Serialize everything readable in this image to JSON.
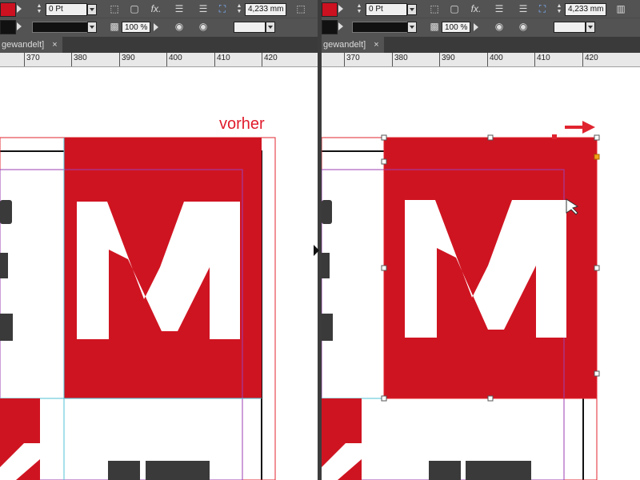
{
  "toolbar": {
    "stroke_weight": "0 Pt",
    "opacity": "100 %",
    "width_value": "4,233 mm",
    "fx_label": "fx."
  },
  "document_tab": {
    "title": "gewandelt]",
    "close": "×"
  },
  "ruler": {
    "left_ticks": [
      "370",
      "380",
      "390",
      "400",
      "410",
      "420"
    ],
    "right_ticks": [
      "370",
      "380",
      "390",
      "400",
      "410",
      "420"
    ]
  },
  "annotation": {
    "vorher": "vorher"
  },
  "logo_letter": "M",
  "colors": {
    "accent_red": "#cf1421",
    "frame_red": "#e0242f",
    "guide_purple": "#9b3fb3",
    "guide_cyan": "#4fc3d6",
    "handle_orange": "#f3a21a"
  },
  "icons": [
    "fill-swatch-icon",
    "stroke-swatch-icon",
    "none-swatch-icon",
    "spinner-icon",
    "dropdown-icon",
    "frame-corner-icon",
    "shadow-icon",
    "effects-fx-icon",
    "align-icon",
    "opacity-icon",
    "fit-frame-icon",
    "text-wrap-icon",
    "close-icon",
    "arrow-right-icon",
    "resize-cursor-icon"
  ]
}
